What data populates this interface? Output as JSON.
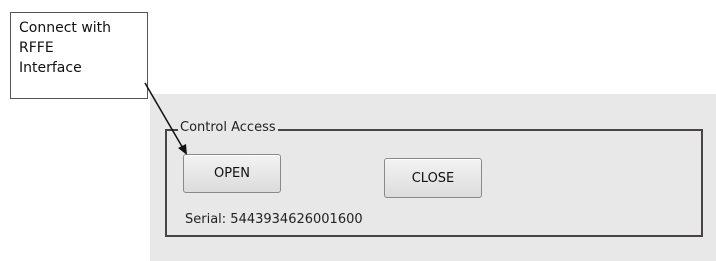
{
  "callout": {
    "lines": [
      "Connect with",
      "RFFE",
      "Interface"
    ]
  },
  "control_access": {
    "title": "Control Access",
    "open_label": "OPEN",
    "close_label": "CLOSE",
    "serial_text": "Serial: 5443934626001600"
  }
}
